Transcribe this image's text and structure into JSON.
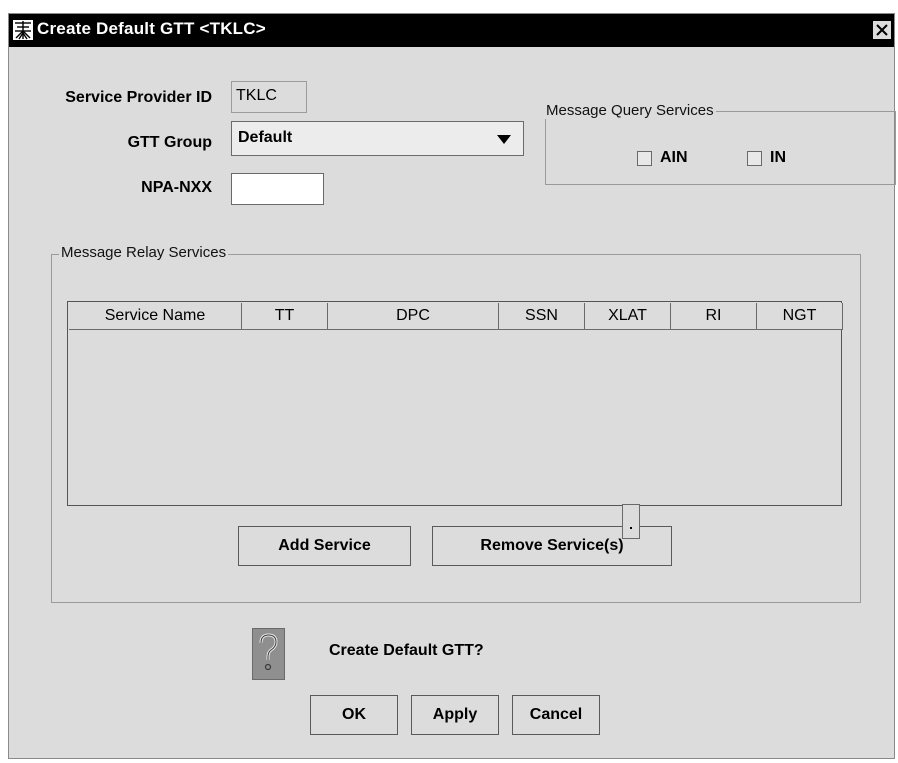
{
  "window": {
    "title": "Create Default GTT <TKLC>"
  },
  "form": {
    "service_provider_label": "Service Provider ID",
    "service_provider_value": "TKLC",
    "gtt_group_label": "GTT Group",
    "gtt_group_value": "Default",
    "npa_nxx_label": "NPA-NXX",
    "npa_nxx_value": ""
  },
  "query_services": {
    "legend": "Message Query Services",
    "options": [
      {
        "label": "AIN",
        "checked": false
      },
      {
        "label": "IN",
        "checked": false
      }
    ]
  },
  "relay_services": {
    "legend": "Message Relay Services",
    "columns": [
      "Service Name",
      "TT",
      "DPC",
      "SSN",
      "XLAT",
      "RI",
      "NGT"
    ],
    "rows": [],
    "add_label": "Add Service",
    "remove_label": "Remove Service(s)"
  },
  "confirm": {
    "icon": "question-icon",
    "message": "Create Default GTT?",
    "ok_label": "OK",
    "apply_label": "Apply",
    "cancel_label": "Cancel"
  }
}
